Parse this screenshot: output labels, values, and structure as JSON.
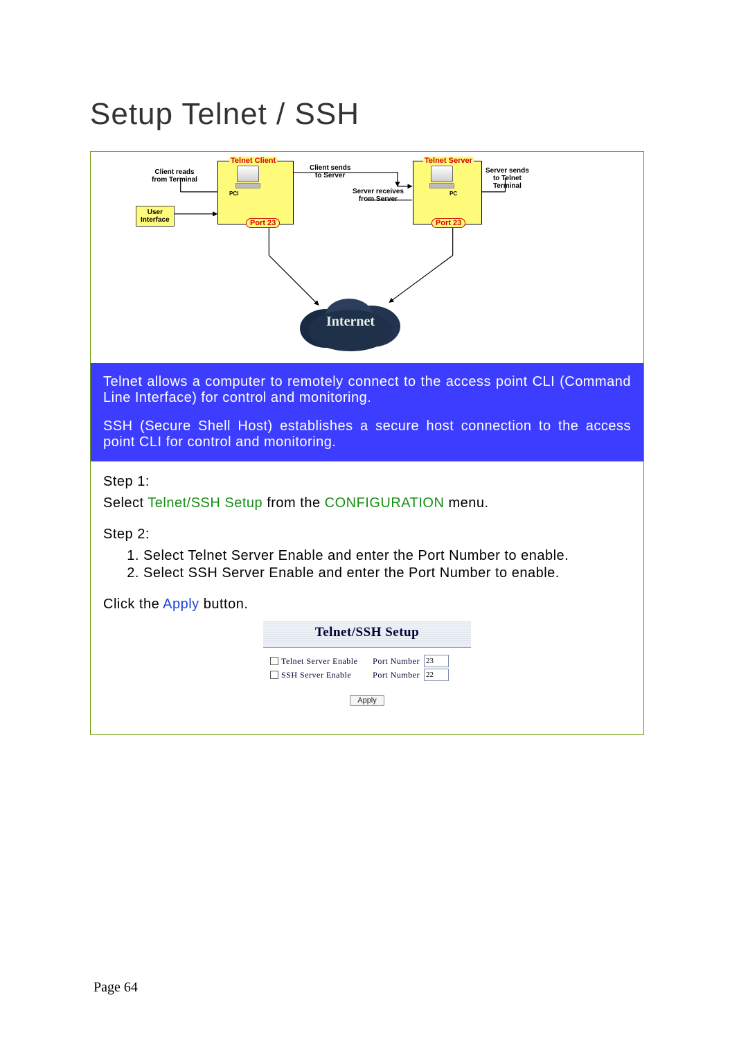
{
  "title": "Setup Telnet / SSH",
  "diagram": {
    "client_box_label": "Telnet Client",
    "server_box_label": "Telnet Server",
    "client_reads": "Client reads\nfrom Terminal",
    "client_sends": "Client sends\nto Server",
    "server_receives": "Server receives\nfrom Server",
    "server_sends": "Server sends\nto Telnet\nTerminal",
    "user_interface": "User\nInterface",
    "port_left": "Port 23",
    "port_right": "Port 23",
    "pci_left": "PCI",
    "pci_right": "PC",
    "internet": "Internet"
  },
  "blue_band": {
    "p1": "Telnet allows a computer to remotely connect to the access point CLI (Command Line Interface) for control and monitoring.",
    "p2": "SSH (Secure Shell Host) establishes a secure host connection to the access point CLI for control and monitoring."
  },
  "steps": {
    "step1_label": "Step 1:",
    "step1_prefix": "Select ",
    "step1_link": "Telnet/SSH Setup",
    "step1_mid": " from the ",
    "step1_menu": "CONFIGURATION",
    "step1_suffix": " menu.",
    "step2_label": "Step 2:",
    "step2_items": [
      "Select Telnet Server Enable and enter the Port Number to enable.",
      "Select SSH Server Enable and enter the Port Number to enable."
    ],
    "click_prefix": "Click the ",
    "click_word": "Apply",
    "click_suffix": " button."
  },
  "panel": {
    "title": "Telnet/SSH Setup",
    "telnet_enable_label": "Telnet Server Enable",
    "telnet_port_label": "Port Number",
    "telnet_port_value": "23",
    "ssh_enable_label": "SSH Server Enable",
    "ssh_port_label": "Port Number",
    "ssh_port_value": "22",
    "apply_label": "Apply"
  },
  "footer": "Page 64"
}
